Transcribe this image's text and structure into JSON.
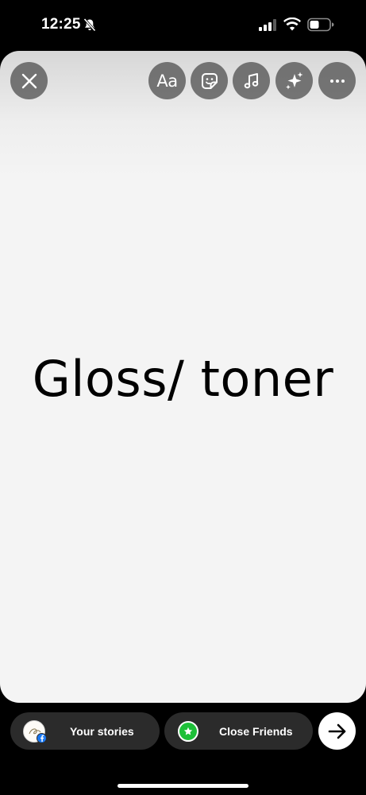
{
  "status_bar": {
    "time": "12:25"
  },
  "toolbar": {
    "text_tool_label": "Aa"
  },
  "story": {
    "text": "Gloss/ toner"
  },
  "share_bar": {
    "your_stories_label": "Your stories",
    "close_friends_label": "Close Friends"
  },
  "colors": {
    "close_friends_green": "#1dbf38",
    "facebook_blue": "#1877f2",
    "pill_background": "#2b2b2b",
    "canvas_background": "#f4f4f4"
  },
  "icons": [
    "mute-bell-icon",
    "signal-icon",
    "wifi-icon",
    "battery-icon",
    "close-icon",
    "sticker-icon",
    "music-note-icon",
    "sparkles-icon",
    "more-icon",
    "facebook-icon",
    "star-icon",
    "arrow-right-icon"
  ]
}
